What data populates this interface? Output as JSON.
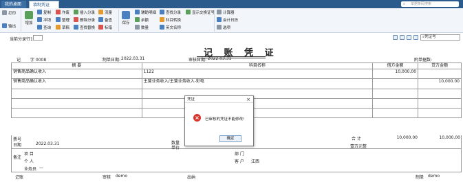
{
  "tabs": {
    "home": "我的桌面",
    "voucher": "填制凭证",
    "close": "×"
  },
  "search": {
    "placeholder": "单据条码搜索",
    "icon": "search-icon"
  },
  "ribbon": {
    "print": "打印",
    "output": "输出",
    "add": "增加",
    "copy": "复制",
    "cut": "冲销",
    "query": "查询",
    "void": "作废",
    "organize": "整理",
    "draft": "草稿",
    "insert_entry": "插入分录",
    "delete_entry": "删除分录",
    "find_replace": "查找替换",
    "flow": "流量",
    "note": "备查",
    "mark": "标错",
    "save": "保存",
    "aux_detail": "辅助明细",
    "balance": "余额",
    "amount": "数量",
    "find_entry": "查找分录",
    "subject_convert": "科目转换",
    "eng_name": "英文名称",
    "show_ref": "显示交换证号",
    "calculator": "计算器",
    "calendar": "会计日历",
    "options": "选项",
    "colors": {
      "blue": "#4a7fc1",
      "green": "#5aa05a",
      "orange": "#e39b2e",
      "red": "#d9534f",
      "gray": "#8a96a3"
    }
  },
  "subbar": {
    "current_row": "当前分录行1",
    "voucher_no_label": "凭证号"
  },
  "voucher": {
    "title": "记 账 凭 证",
    "type_label": "记",
    "no_label": "字 0008",
    "date_label": "制单日期:",
    "date": "2022.03.31",
    "audit_label": "审核日期:",
    "audit_date": "2022.03.31",
    "attach_label": "附单据数:",
    "headers": {
      "summary": "摘 要",
      "subject": "科目名称",
      "debit": "借方金额",
      "credit": "贷方金额"
    },
    "rows": [
      {
        "summary": "销售商品确认收入",
        "subject": "1122",
        "debit": "10,000.00",
        "credit": ""
      },
      {
        "summary": "销售商品确认收入",
        "subject": "主营业务收入/主营业务收入-彩电",
        "debit": "",
        "credit": "10,000.00"
      },
      {
        "summary": "",
        "subject": "",
        "debit": "",
        "credit": ""
      },
      {
        "summary": "",
        "subject": "",
        "debit": "",
        "credit": ""
      },
      {
        "summary": "",
        "subject": "",
        "debit": "",
        "credit": ""
      }
    ],
    "footer": {
      "ticket_label": "票号",
      "ticket_date_label": "日期",
      "ticket_date": "2022.03.31",
      "qty_label": "数量",
      "unit_label": "单价",
      "total_label": "合 计",
      "total_debit": "10,000.00",
      "total_credit": "10,000.00",
      "big_amount": "壹万元整",
      "remark_label": "备注",
      "project_label": "项 目",
      "personal_label": "个 人",
      "salesman_label": "业务员",
      "salesman_value": "—",
      "dept_label": "部 门",
      "customer_label": "客 户",
      "customer_value": "江西"
    },
    "sign": {
      "bookkeep": "记账",
      "audit": "审核",
      "audit_val": "demo",
      "cashier": "出纳",
      "maker": "制单",
      "maker_val": "demo"
    }
  },
  "dialog": {
    "title": "凭证",
    "close": "×",
    "message": "已审核的凭证不能修改!",
    "ok": "确定",
    "error_icon": "error-icon"
  }
}
